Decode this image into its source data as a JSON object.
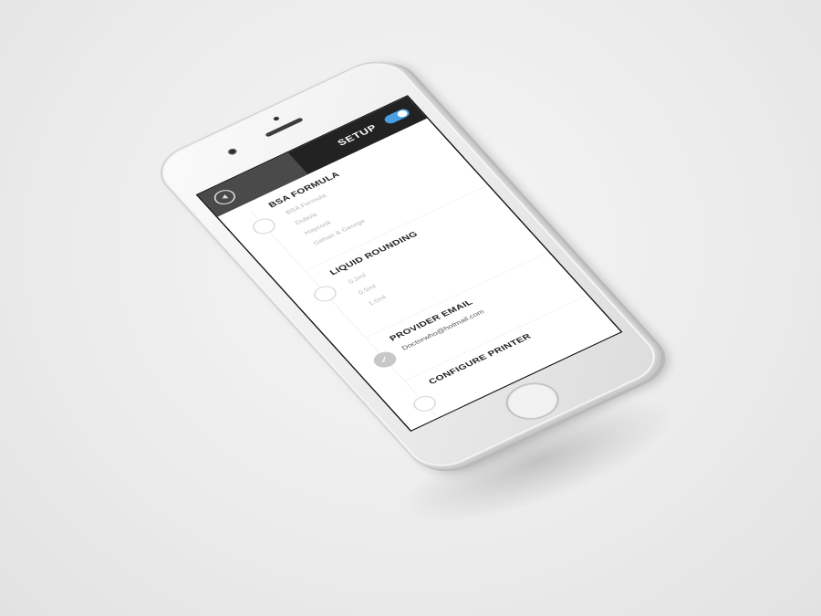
{
  "header": {
    "title": "SETUP"
  },
  "sections": [
    {
      "title": "BSA FORMULA",
      "options": [
        "BSA Formula",
        "Dubois",
        "Haycock",
        "Gehan & George"
      ],
      "checked": false
    },
    {
      "title": "LIQUID ROUNDING",
      "options": [
        "0.2ml",
        "0.5ml",
        "1.0ml"
      ],
      "checked": false
    },
    {
      "title": "PROVIDER EMAIL",
      "value": "Doctorwho@hotmail.com",
      "checked": true
    },
    {
      "title": "CONFIGURE PRINTER",
      "checked": false
    }
  ],
  "colors": {
    "header_bg": "#222222",
    "toggle_on": "#4a9fe0",
    "checked_circle": "#c8c8c8"
  },
  "icons": {
    "back": "back-arrow-icon",
    "check": "checkmark-icon"
  }
}
